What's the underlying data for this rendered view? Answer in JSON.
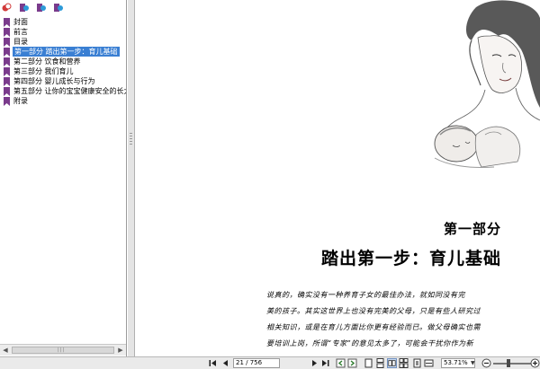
{
  "sidebar": {
    "toolbar": [
      {
        "icon": "expand-bookmark-icon"
      },
      {
        "icon": "add-bookmark-icon"
      },
      {
        "icon": "bookmark-options-icon"
      },
      {
        "icon": "delete-bookmark-icon"
      }
    ],
    "bookmarks": [
      {
        "label": "封面",
        "selected": false
      },
      {
        "label": "前言",
        "selected": false
      },
      {
        "label": "目录",
        "selected": false
      },
      {
        "label": "第一部分 踏出第一步：育儿基础",
        "selected": true
      },
      {
        "label": "第二部分 饮食和营养",
        "selected": false
      },
      {
        "label": "第三部分 我们育儿",
        "selected": false
      },
      {
        "label": "第四部分 婴儿成长与行为",
        "selected": false
      },
      {
        "label": "第五部分 让你的宝宝健康安全的长大",
        "selected": false
      },
      {
        "label": "附录",
        "selected": false
      }
    ],
    "accent_color": "#3a7fd3",
    "flag_color": "#7a3b8c"
  },
  "document": {
    "part_heading": "第一部分",
    "part_title": "踏出第一步：育儿基础",
    "body_lines": [
      "说真的，确实没有一种养育子女的最佳办法，就如同没有完",
      "美的孩子。其实这世界上也没有完美的父母，只是有些人研究过",
      "相关知识，或是在育儿方面比你更有经验而已。做父母确实也需",
      "要培训上岗，所谓“专家”的意见太多了，可能会干扰你作为新"
    ]
  },
  "statusbar": {
    "page_indicator": "21 / 756",
    "zoom": "53.71%"
  }
}
